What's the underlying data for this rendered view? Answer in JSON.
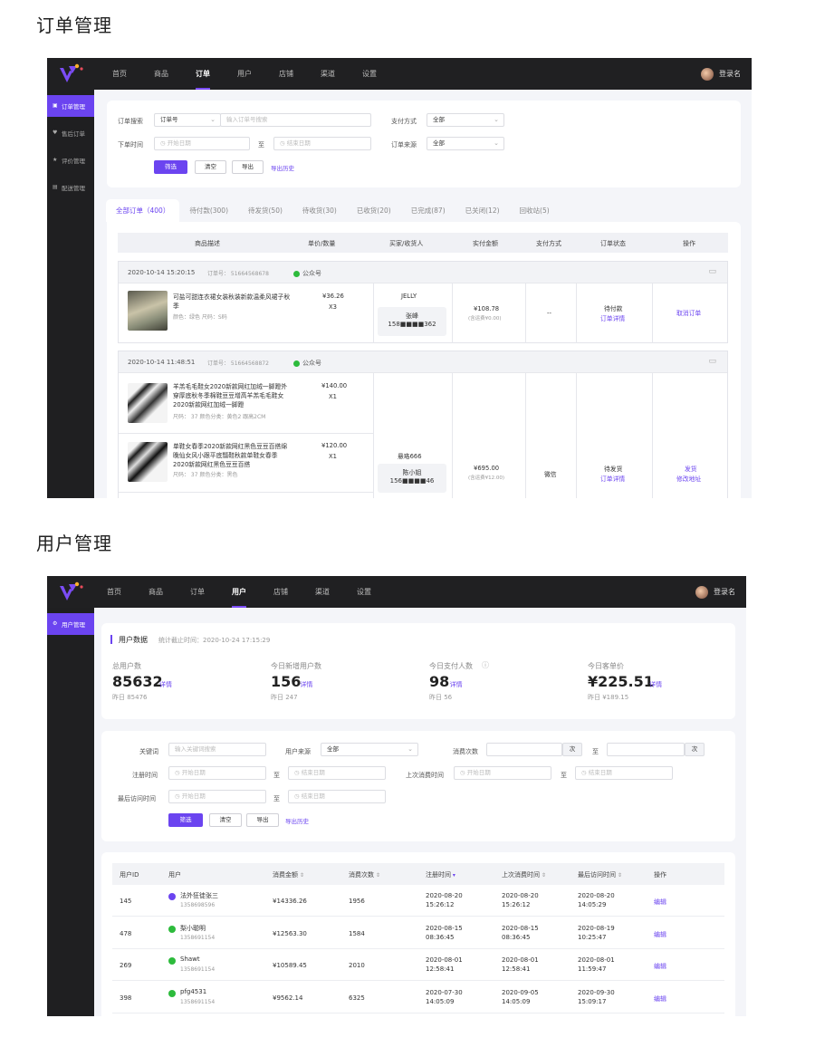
{
  "section1_title": "订单管理",
  "section2_title": "用户管理",
  "nav1": {
    "items": [
      "首页",
      "商品",
      "订单",
      "用户",
      "店铺",
      "渠道",
      "设置"
    ],
    "active": "订单"
  },
  "nav2": {
    "items": [
      "首页",
      "商品",
      "订单",
      "用户",
      "店铺",
      "渠道",
      "设置"
    ],
    "active": "用户"
  },
  "user_label": "登录名",
  "sidebar1": [
    "订单管理",
    "售后订单",
    "评价管理",
    "配送管理"
  ],
  "sidebar2": [
    "用户管理"
  ],
  "order_filter": {
    "search_label": "订单搜索",
    "search_type": "订单号",
    "search_placeholder": "输入订单号搜索",
    "pay_label": "支付方式",
    "pay_value": "全部",
    "time_label": "下单时间",
    "start_placeholder": "开始日期",
    "to": "至",
    "end_placeholder": "结束日期",
    "source_label": "订单来源",
    "source_value": "全部",
    "filter_btn": "筛选",
    "clear_btn": "清空",
    "export_btn": "导出",
    "history_link": "导出历史"
  },
  "order_tabs": [
    "全部订单（400）",
    "待付款(300)",
    "待发货(50)",
    "待收货(30)",
    "已收货(20)",
    "已完成(87)",
    "已关闭(12)",
    "回收站(5)"
  ],
  "order_columns": [
    "商品描述",
    "单价/数量",
    "买家/收货人",
    "实付金额",
    "支付方式",
    "订单状态",
    "操作"
  ],
  "order1": {
    "time": "2020-10-14 15:20:15",
    "no": "订单号： 51664568678",
    "channel": "公众号",
    "product": "可盐可甜连衣裙女装秋装新款温柔风裙子秋季",
    "spec": "颜色：绿色  尺码：S码",
    "price": "¥36.26",
    "qty": "X3",
    "buyer": "JELLY",
    "receiver": "张峰",
    "phone": "158■■■■362",
    "paid": "¥108.78",
    "freight": "(含运费¥0.00)",
    "pay_method": "--",
    "status": "待付款",
    "detail": "订单详情",
    "action": "取消订单"
  },
  "order2": {
    "time": "2020-10-14 11:48:51",
    "no": "订单号： 51664568872",
    "channel": "公众号",
    "item1": {
      "name": "羊羔毛毛鞋女2020新款网红加绒一脚蹬外穿厚底秋冬季棉鞋豆豆增高羊羔毛毛鞋女2020新款网红加绒一脚蹬",
      "spec": "尺码： 37   颜色分类：黄色2 跟高2CM",
      "price": "¥140.00",
      "qty": "X1"
    },
    "item2": {
      "name": "单鞋女春季2020新款网红黑色豆豆百搭绵晚仙女风小跟平底瓢鞋秋款单鞋女春季2020新款网红黑色豆豆百搭",
      "spec": "尺码： 37   颜色分类：黑色",
      "price": "¥120.00",
      "qty": "X1"
    },
    "buyer": "悬珞666",
    "receiver": "陈小姐",
    "phone": "156■■■■46",
    "paid": "¥695.00",
    "freight": "(含运费¥12.00)",
    "pay_method": "微信",
    "status": "待发货",
    "detail": "订单详情",
    "action1": "发货",
    "action2": "修改地址"
  },
  "user_stats": {
    "title": "用户数据",
    "cutoff": "统计截止时间：2020-10-24 17:15:29",
    "items": [
      {
        "label": "总用户数",
        "value": "85632",
        "link": "详情",
        "sub": "昨日 85476"
      },
      {
        "label": "今日新增用户数",
        "value": "156",
        "link": "详情",
        "sub": "昨日 247"
      },
      {
        "label": "今日支付人数",
        "value": "98",
        "link": "详情",
        "sub": "昨日 56"
      },
      {
        "label": "今日客单价",
        "value": "¥225.51",
        "link": "详情",
        "sub": "昨日 ¥189.15"
      }
    ]
  },
  "user_filter": {
    "keyword_label": "关键词",
    "keyword_placeholder": "输入关键词搜索",
    "source_label": "用户来源",
    "source_value": "全部",
    "count_label": "消费次数",
    "times": "次",
    "to": "至",
    "reg_label": "注册时间",
    "last_buy_label": "上次消费时间",
    "last_visit_label": "最后访问时间",
    "start_placeholder": "开始日期",
    "end_placeholder": "结束日期",
    "filter_btn": "筛选",
    "clear_btn": "清空",
    "export_btn": "导出",
    "history_link": "导出历史"
  },
  "user_columns": [
    "用户ID",
    "用户",
    "消费金额",
    "消费次数",
    "注册时间",
    "上次消费时间",
    "最后访问时间",
    "操作"
  ],
  "user_rows": [
    {
      "id": "145",
      "name": "法外狂徒张三",
      "phone": "1358698596",
      "amount": "¥14336.26",
      "count": "1956",
      "reg_date": "2020-08-20",
      "reg_time": "15:26:12",
      "last_date": "2020-08-20",
      "last_time": "15:26:12",
      "visit_date": "2020-08-20",
      "visit_time": "14:05:29",
      "action": "编辑",
      "src": "purple"
    },
    {
      "id": "478",
      "name": "梨小聪明",
      "phone": "1358691154",
      "amount": "¥12563.30",
      "count": "1584",
      "reg_date": "2020-08-15",
      "reg_time": "08:36:45",
      "last_date": "2020-08-15",
      "last_time": "08:36:45",
      "visit_date": "2020-08-19",
      "visit_time": "10:25:47",
      "action": "编辑",
      "src": "green"
    },
    {
      "id": "269",
      "name": "Shawt",
      "phone": "1358691154",
      "amount": "¥10589.45",
      "count": "2010",
      "reg_date": "2020-08-01",
      "reg_time": "12:58:41",
      "last_date": "2020-08-01",
      "last_time": "12:58:41",
      "visit_date": "2020-08-01",
      "visit_time": "11:59:47",
      "action": "编辑",
      "src": "green"
    },
    {
      "id": "398",
      "name": "pfg4531",
      "phone": "1358691154",
      "amount": "¥9562.14",
      "count": "6325",
      "reg_date": "2020-07-30",
      "reg_time": "14:05:09",
      "last_date": "2020-09-05",
      "last_time": "14:05:09",
      "visit_date": "2020-09-30",
      "visit_time": "15:09:17",
      "action": "编辑",
      "src": "green"
    }
  ]
}
